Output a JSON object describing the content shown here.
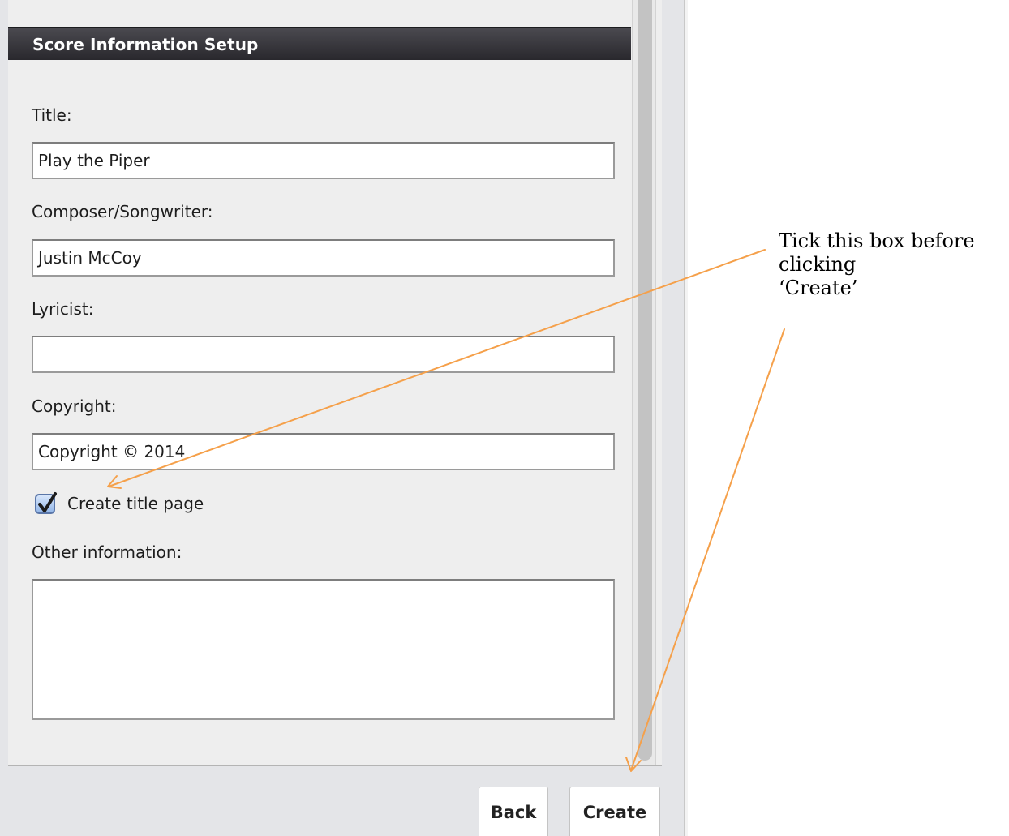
{
  "dialog": {
    "header_title": "Score Information Setup",
    "fields": {
      "title": {
        "label": "Title:",
        "value": "Play the Piper"
      },
      "composer": {
        "label": "Composer/Songwriter:",
        "value": "Justin McCoy"
      },
      "lyricist": {
        "label": "Lyricist:",
        "value": ""
      },
      "copyright": {
        "label": "Copyright:",
        "value": "Copyright © 2014"
      },
      "other": {
        "label": "Other information:",
        "value": ""
      }
    },
    "create_title_page": {
      "label": "Create title page",
      "checked": true
    },
    "buttons": {
      "back": "Back",
      "create": "Create"
    }
  },
  "annotation": {
    "lines": [
      "Tick this box before",
      "clicking",
      "‘Create’"
    ],
    "arrow_color": "#f5a04a"
  },
  "colors": {
    "header_bg": "#2e2d32",
    "panel_bg": "#eeeeee",
    "checkbox_fill": "#a9c6ee"
  }
}
